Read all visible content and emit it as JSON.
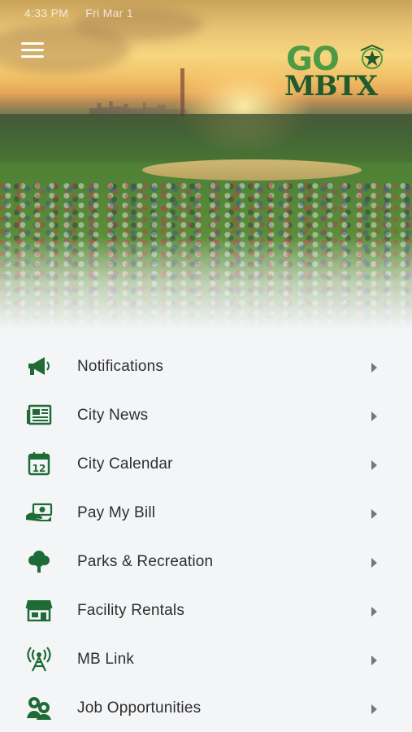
{
  "status_bar": {
    "time": "4:33 PM",
    "date": "Fri Mar 1"
  },
  "header": {
    "menu_icon": "hamburger-menu-icon"
  },
  "logo": {
    "line1": "GO",
    "line2": "MBTX"
  },
  "colors": {
    "brand_dark": "#1f5b2c",
    "brand_light": "#4e9a45",
    "icon": "#1f6b35",
    "text": "#2e2e2e",
    "background": "#f4f5f7"
  },
  "menu": {
    "items": [
      {
        "label": "Notifications",
        "icon": "megaphone-icon"
      },
      {
        "label": "City News",
        "icon": "newspaper-icon"
      },
      {
        "label": "City Calendar",
        "icon": "calendar-icon"
      },
      {
        "label": "Pay My Bill",
        "icon": "money-hand-icon"
      },
      {
        "label": "Parks & Recreation",
        "icon": "tree-icon"
      },
      {
        "label": "Facility Rentals",
        "icon": "storefront-icon"
      },
      {
        "label": "MB Link",
        "icon": "broadcast-tower-icon"
      },
      {
        "label": "Job Opportunities",
        "icon": "people-icon"
      }
    ]
  }
}
